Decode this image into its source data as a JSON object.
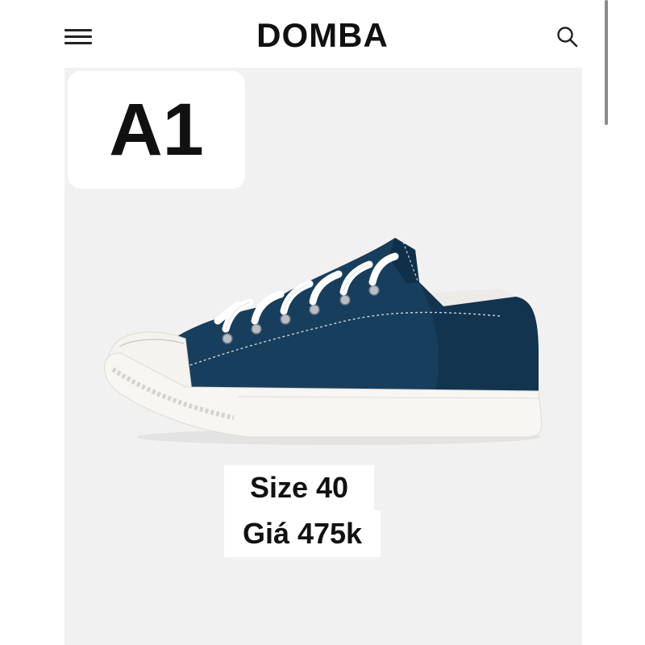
{
  "header": {
    "brand": "DOMBA",
    "menu_icon": "hamburger-menu-icon",
    "search_icon": "search-icon"
  },
  "product": {
    "label": "A1",
    "size_text": "Size 40",
    "price_text": "Giá 475k",
    "image": "navy-low-top-canvas-sneaker"
  },
  "colors": {
    "shoe_upper": "#173e5c",
    "panel_bg": "#f2f1f1",
    "text": "#111111"
  }
}
